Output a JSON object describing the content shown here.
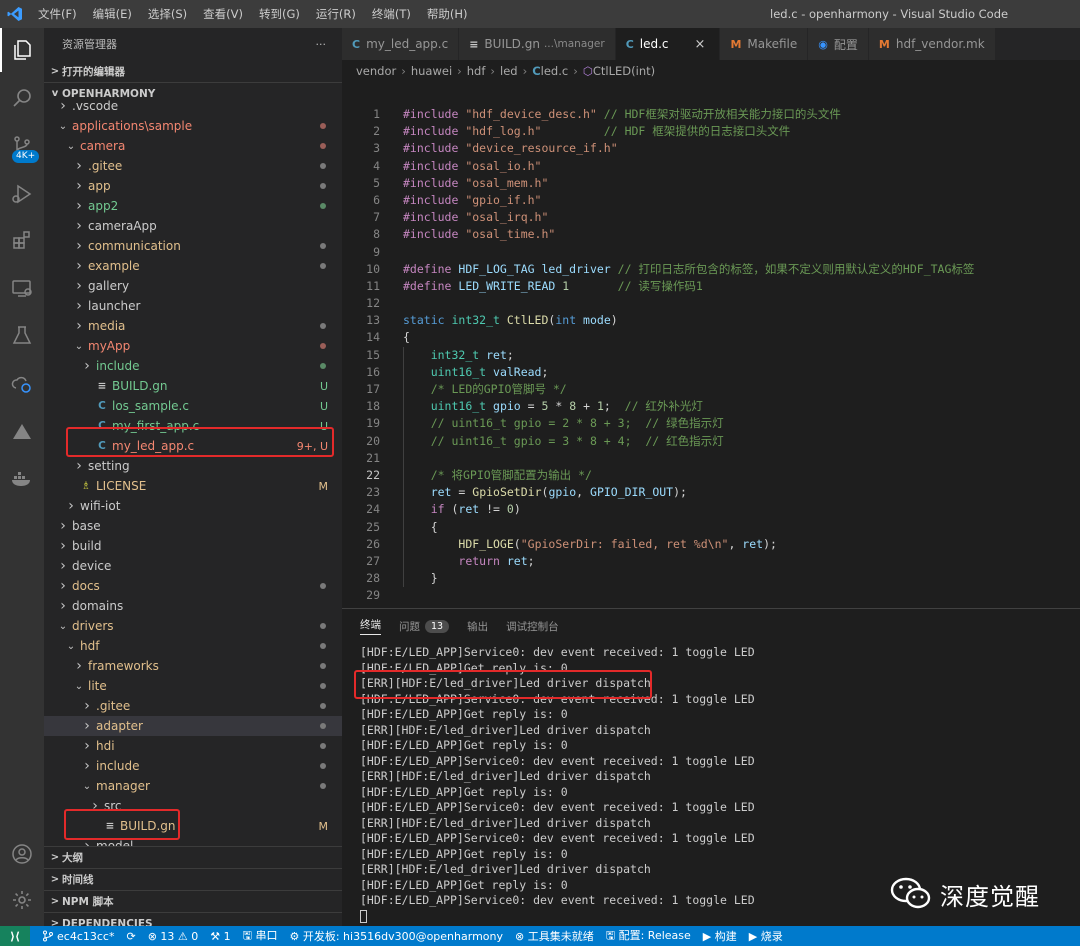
{
  "titlebar": {
    "menu": [
      "文件(F)",
      "编辑(E)",
      "选择(S)",
      "查看(V)",
      "转到(G)",
      "运行(R)",
      "终端(T)",
      "帮助(H)"
    ],
    "window_title": "led.c - openharmony - Visual Studio Code"
  },
  "activity": {
    "badge": "4K+",
    "icons": [
      "explorer-icon",
      "search-icon",
      "source-control-icon",
      "run-debug-icon",
      "extensions-icon",
      "remote-explorer-icon",
      "testing-icon",
      "timeline-icon",
      "deploy-icon",
      "docker-icon",
      "account-icon",
      "settings-gear-icon"
    ]
  },
  "sidebar": {
    "title": "资源管理器",
    "more": "···",
    "open_editors": "打开的编辑器",
    "root": "OPENHARMONY",
    "tree": [
      {
        "label": ".vscode",
        "depth": 1,
        "color": "gray",
        "twisty": ">",
        "icon": "",
        "dec": "",
        "dot": ""
      },
      {
        "label": "applications\\sample",
        "depth": 1,
        "color": "red",
        "twisty": "v",
        "icon": "",
        "dec": "",
        "dot": "red"
      },
      {
        "label": "camera",
        "depth": 2,
        "color": "red",
        "twisty": "v",
        "icon": "",
        "dec": "",
        "dot": "red"
      },
      {
        "label": ".gitee",
        "depth": 3,
        "color": "yellow",
        "twisty": ">",
        "icon": "",
        "dec": "",
        "dot": "gray"
      },
      {
        "label": "app",
        "depth": 3,
        "color": "yellow",
        "twisty": ">",
        "icon": "",
        "dec": "",
        "dot": "gray"
      },
      {
        "label": "app2",
        "depth": 3,
        "color": "green",
        "twisty": ">",
        "icon": "",
        "dec": "",
        "dot": "green"
      },
      {
        "label": "cameraApp",
        "depth": 3,
        "color": "gray",
        "twisty": ">",
        "icon": "",
        "dec": "",
        "dot": ""
      },
      {
        "label": "communication",
        "depth": 3,
        "color": "yellow",
        "twisty": ">",
        "icon": "",
        "dec": "",
        "dot": "gray"
      },
      {
        "label": "example",
        "depth": 3,
        "color": "yellow",
        "twisty": ">",
        "icon": "",
        "dec": "",
        "dot": "gray"
      },
      {
        "label": "gallery",
        "depth": 3,
        "color": "gray",
        "twisty": ">",
        "icon": "",
        "dec": "",
        "dot": ""
      },
      {
        "label": "launcher",
        "depth": 3,
        "color": "gray",
        "twisty": ">",
        "icon": "",
        "dec": "",
        "dot": ""
      },
      {
        "label": "media",
        "depth": 3,
        "color": "yellow",
        "twisty": ">",
        "icon": "",
        "dec": "",
        "dot": "gray"
      },
      {
        "label": "myApp",
        "depth": 3,
        "color": "red",
        "twisty": "v",
        "icon": "",
        "dec": "",
        "dot": "red"
      },
      {
        "label": "include",
        "depth": 4,
        "color": "green",
        "twisty": ">",
        "icon": "",
        "dec": "",
        "dot": "green"
      },
      {
        "label": "BUILD.gn",
        "depth": 4,
        "color": "green",
        "twisty": "",
        "icon": "≡",
        "dec": "U",
        "dot": ""
      },
      {
        "label": "los_sample.c",
        "depth": 4,
        "color": "green",
        "twisty": "",
        "icon": "C",
        "dec": "U",
        "dot": ""
      },
      {
        "label": "my_first_app.c",
        "depth": 4,
        "color": "green",
        "twisty": "",
        "icon": "C",
        "dec": "U",
        "dot": ""
      },
      {
        "label": "my_led_app.c",
        "depth": 4,
        "color": "red",
        "twisty": "",
        "icon": "C",
        "dec": "9+, U",
        "dot": ""
      },
      {
        "label": "setting",
        "depth": 3,
        "color": "gray",
        "twisty": ">",
        "icon": "",
        "dec": "",
        "dot": ""
      },
      {
        "label": "LICENSE",
        "depth": 2,
        "color": "yellow",
        "twisty": "",
        "icon": "♗",
        "dec": "M",
        "dot": ""
      },
      {
        "label": "wifi-iot",
        "depth": 2,
        "color": "gray",
        "twisty": ">",
        "icon": "",
        "dec": "",
        "dot": ""
      },
      {
        "label": "base",
        "depth": 1,
        "color": "gray",
        "twisty": ">",
        "icon": "",
        "dec": "",
        "dot": ""
      },
      {
        "label": "build",
        "depth": 1,
        "color": "gray",
        "twisty": ">",
        "icon": "",
        "dec": "",
        "dot": ""
      },
      {
        "label": "device",
        "depth": 1,
        "color": "gray",
        "twisty": ">",
        "icon": "",
        "dec": "",
        "dot": ""
      },
      {
        "label": "docs",
        "depth": 1,
        "color": "yellow",
        "twisty": ">",
        "icon": "",
        "dec": "",
        "dot": "gray"
      },
      {
        "label": "domains",
        "depth": 1,
        "color": "gray",
        "twisty": ">",
        "icon": "",
        "dec": "",
        "dot": ""
      },
      {
        "label": "drivers",
        "depth": 1,
        "color": "yellow",
        "twisty": "v",
        "icon": "",
        "dec": "",
        "dot": "gray"
      },
      {
        "label": "hdf",
        "depth": 2,
        "color": "yellow",
        "twisty": "v",
        "icon": "",
        "dec": "",
        "dot": "gray"
      },
      {
        "label": "frameworks",
        "depth": 3,
        "color": "yellow",
        "twisty": ">",
        "icon": "",
        "dec": "",
        "dot": "gray"
      },
      {
        "label": "lite",
        "depth": 3,
        "color": "yellow",
        "twisty": "v",
        "icon": "",
        "dec": "",
        "dot": "gray"
      },
      {
        "label": ".gitee",
        "depth": 4,
        "color": "yellow",
        "twisty": ">",
        "icon": "",
        "dec": "",
        "dot": "gray"
      },
      {
        "label": "adapter",
        "depth": 4,
        "color": "yellow",
        "twisty": ">",
        "icon": "",
        "dec": "",
        "dot": "gray",
        "selected": true
      },
      {
        "label": "hdi",
        "depth": 4,
        "color": "yellow",
        "twisty": ">",
        "icon": "",
        "dec": "",
        "dot": "gray"
      },
      {
        "label": "include",
        "depth": 4,
        "color": "yellow",
        "twisty": ">",
        "icon": "",
        "dec": "",
        "dot": "gray"
      },
      {
        "label": "manager",
        "depth": 4,
        "color": "yellow",
        "twisty": "v",
        "icon": "",
        "dec": "",
        "dot": "gray"
      },
      {
        "label": "src",
        "depth": 5,
        "color": "gray",
        "twisty": ">",
        "icon": "",
        "dec": "",
        "dot": ""
      },
      {
        "label": "BUILD.gn",
        "depth": 5,
        "color": "yellow",
        "twisty": "",
        "icon": "≡",
        "dec": "M",
        "dot": ""
      },
      {
        "label": "model",
        "depth": 4,
        "color": "gray",
        "twisty": ">",
        "icon": "",
        "dec": "",
        "dot": ""
      }
    ],
    "bottom_sections": [
      "大纲",
      "时间线",
      "NPM 脚本",
      "DEPENDENCIES"
    ]
  },
  "editor": {
    "tabs": [
      {
        "icon": "C",
        "label": "my_led_app.c",
        "desc": "",
        "active": false,
        "iconColor": "#519aba"
      },
      {
        "icon": "≡",
        "label": "BUILD.gn",
        "desc": "...\\manager",
        "active": false,
        "iconColor": "#cccccc"
      },
      {
        "icon": "C",
        "label": "led.c",
        "desc": "",
        "active": true,
        "close": "×",
        "iconColor": "#519aba"
      },
      {
        "icon": "M",
        "label": "Makefile",
        "desc": "",
        "active": false,
        "iconColor": "#e37933"
      },
      {
        "icon": "◉",
        "label": "配置",
        "desc": "",
        "active": false,
        "iconColor": "#3794ff"
      },
      {
        "icon": "M",
        "label": "hdf_vendor.mk",
        "desc": "",
        "active": false,
        "iconColor": "#e37933"
      }
    ],
    "breadcrumb": [
      "vendor",
      "huawei",
      "hdf",
      "led",
      "led.c",
      "CtlLED(int)"
    ],
    "lines": [
      {
        "n": "1",
        "segs": [
          [
            "k",
            "#include "
          ],
          [
            "s",
            "\"hdf_device_desc.h\""
          ],
          [
            "c",
            " // HDF框架对驱动开放相关能力接口的头文件"
          ]
        ]
      },
      {
        "n": "2",
        "segs": [
          [
            "k",
            "#include "
          ],
          [
            "s",
            "\"hdf_log.h\""
          ],
          [
            "c",
            "         // HDF 框架提供的日志接口头文件"
          ]
        ]
      },
      {
        "n": "3",
        "segs": [
          [
            "k",
            "#include "
          ],
          [
            "s",
            "\"device_resource_if.h\""
          ]
        ]
      },
      {
        "n": "4",
        "segs": [
          [
            "k",
            "#include "
          ],
          [
            "s",
            "\"osal_io.h\""
          ]
        ]
      },
      {
        "n": "5",
        "segs": [
          [
            "k",
            "#include "
          ],
          [
            "s",
            "\"osal_mem.h\""
          ]
        ]
      },
      {
        "n": "6",
        "segs": [
          [
            "k",
            "#include "
          ],
          [
            "s",
            "\"gpio_if.h\""
          ]
        ]
      },
      {
        "n": "7",
        "segs": [
          [
            "k",
            "#include "
          ],
          [
            "s",
            "\"osal_irq.h\""
          ]
        ]
      },
      {
        "n": "8",
        "segs": [
          [
            "k",
            "#include "
          ],
          [
            "s",
            "\"osal_time.h\""
          ]
        ]
      },
      {
        "n": "9",
        "segs": []
      },
      {
        "n": "10",
        "segs": [
          [
            "k",
            "#define "
          ],
          [
            "v",
            "HDF_LOG_TAG "
          ],
          [
            "v",
            "led_driver"
          ],
          [
            "c",
            " // 打印日志所包含的标签，如果不定义则用默认定义的HDF_TAG标签"
          ]
        ]
      },
      {
        "n": "11",
        "segs": [
          [
            "k",
            "#define "
          ],
          [
            "v",
            "LED_WRITE_READ "
          ],
          [
            "n",
            "1"
          ],
          [
            "c",
            "       // 读写操作码1"
          ]
        ]
      },
      {
        "n": "12",
        "segs": []
      },
      {
        "n": "13",
        "segs": [
          [
            "kw",
            "static "
          ],
          [
            "t",
            "int32_t "
          ],
          [
            "f",
            "CtlLED"
          ],
          [
            "p",
            "("
          ],
          [
            "kw",
            "int "
          ],
          [
            "v",
            "mode"
          ],
          [
            "p",
            ")"
          ]
        ]
      },
      {
        "n": "14",
        "segs": [
          [
            "p",
            "{"
          ]
        ]
      },
      {
        "n": "15",
        "segs": [
          [
            "p",
            "    "
          ],
          [
            "t",
            "int32_t "
          ],
          [
            "v",
            "ret"
          ],
          [
            "p",
            ";"
          ]
        ]
      },
      {
        "n": "16",
        "segs": [
          [
            "p",
            "    "
          ],
          [
            "t",
            "uint16_t "
          ],
          [
            "v",
            "valRead"
          ],
          [
            "p",
            ";"
          ]
        ]
      },
      {
        "n": "17",
        "segs": [
          [
            "p",
            "    "
          ],
          [
            "c",
            "/* LED的GPIO管脚号 */"
          ]
        ]
      },
      {
        "n": "18",
        "segs": [
          [
            "p",
            "    "
          ],
          [
            "t",
            "uint16_t "
          ],
          [
            "v",
            "gpio "
          ],
          [
            "p",
            "= "
          ],
          [
            "n",
            "5 "
          ],
          [
            "p",
            "* "
          ],
          [
            "n",
            "8 "
          ],
          [
            "p",
            "+ "
          ],
          [
            "n",
            "1"
          ],
          [
            "p",
            ";  "
          ],
          [
            "c",
            "// 红外补光灯"
          ]
        ]
      },
      {
        "n": "19",
        "segs": [
          [
            "p",
            "    "
          ],
          [
            "c",
            "// uint16_t gpio = 2 * 8 + 3;  // 绿色指示灯"
          ]
        ]
      },
      {
        "n": "20",
        "segs": [
          [
            "p",
            "    "
          ],
          [
            "c",
            "// uint16_t gpio = 3 * 8 + 4;  // 红色指示灯"
          ]
        ]
      },
      {
        "n": "21",
        "segs": []
      },
      {
        "n": "22",
        "segs": [
          [
            "p",
            "    "
          ],
          [
            "c",
            "/* 将GPIO管脚配置为输出 */"
          ]
        ],
        "cur": true
      },
      {
        "n": "23",
        "segs": [
          [
            "p",
            "    "
          ],
          [
            "v",
            "ret "
          ],
          [
            "p",
            "= "
          ],
          [
            "f",
            "GpioSetDir"
          ],
          [
            "p",
            "("
          ],
          [
            "v",
            "gpio"
          ],
          [
            "p",
            ", "
          ],
          [
            "v",
            "GPIO_DIR_OUT"
          ],
          [
            "p",
            ");"
          ]
        ]
      },
      {
        "n": "24",
        "segs": [
          [
            "p",
            "    "
          ],
          [
            "k",
            "if "
          ],
          [
            "p",
            "("
          ],
          [
            "v",
            "ret "
          ],
          [
            "p",
            "!= "
          ],
          [
            "n",
            "0"
          ],
          [
            "p",
            ")"
          ]
        ]
      },
      {
        "n": "25",
        "segs": [
          [
            "p",
            "    {"
          ]
        ]
      },
      {
        "n": "26",
        "segs": [
          [
            "p",
            "        "
          ],
          [
            "f",
            "HDF_LOGE"
          ],
          [
            "p",
            "("
          ],
          [
            "s",
            "\"GpioSerDir: failed, ret %d\\n\""
          ],
          [
            "p",
            ", "
          ],
          [
            "v",
            "ret"
          ],
          [
            "p",
            ");"
          ]
        ]
      },
      {
        "n": "27",
        "segs": [
          [
            "p",
            "        "
          ],
          [
            "k",
            "return "
          ],
          [
            "v",
            "ret"
          ],
          [
            "p",
            ";"
          ]
        ]
      },
      {
        "n": "28",
        "segs": [
          [
            "p",
            "    }"
          ]
        ]
      },
      {
        "n": "29",
        "segs": []
      }
    ]
  },
  "panel": {
    "tabs": [
      {
        "label": "终端",
        "active": true,
        "badge": ""
      },
      {
        "label": "问题",
        "active": false,
        "badge": "13"
      },
      {
        "label": "输出",
        "active": false,
        "badge": ""
      },
      {
        "label": "调试控制台",
        "active": false,
        "badge": ""
      }
    ],
    "terminal": [
      "[HDF:E/LED_APP]Service0: dev event received: 1 toggle LED",
      "[HDF:E/LED_APP]Get reply is: 0",
      "[ERR][HDF:E/led_driver]Led driver dispatch",
      "[HDF:E/LED_APP]Service0: dev event received: 1 toggle LED",
      "[HDF:E/LED_APP]Get reply is: 0",
      "[ERR][HDF:E/led_driver]Led driver dispatch",
      "[HDF:E/LED_APP]Get reply is: 0",
      "[HDF:E/LED_APP]Service0: dev event received: 1 toggle LED",
      "[ERR][HDF:E/led_driver]Led driver dispatch",
      "[HDF:E/LED_APP]Get reply is: 0",
      "[HDF:E/LED_APP]Service0: dev event received: 1 toggle LED",
      "[ERR][HDF:E/led_driver]Led driver dispatch",
      "[HDF:E/LED_APP]Service0: dev event received: 1 toggle LED",
      "[HDF:E/LED_APP]Get reply is: 0",
      "[ERR][HDF:E/led_driver]Led driver dispatch",
      "[HDF:E/LED_APP]Get reply is: 0",
      "[HDF:E/LED_APP]Service0: dev event received: 1 toggle LED"
    ]
  },
  "watermark": {
    "text": "深度觉醒"
  },
  "statusbar": {
    "remote": "⟩⟨",
    "branch": "ec4c13cc*",
    "sync": "⟳",
    "problems": "⊗ 13 ⚠ 0",
    "ports": "⚒ 1",
    "serial": "🖫 串口",
    "board": "⚙ 开发板: hi3516dv300@openharmony",
    "toolchain": "⊗ 工具集未就绪",
    "config": "🖫 配置: Release",
    "build": "▶ 构建",
    "flash": "▶ 烧录"
  },
  "colors": {
    "accent": "#007acc",
    "highlight_box": "#e32a2a"
  }
}
